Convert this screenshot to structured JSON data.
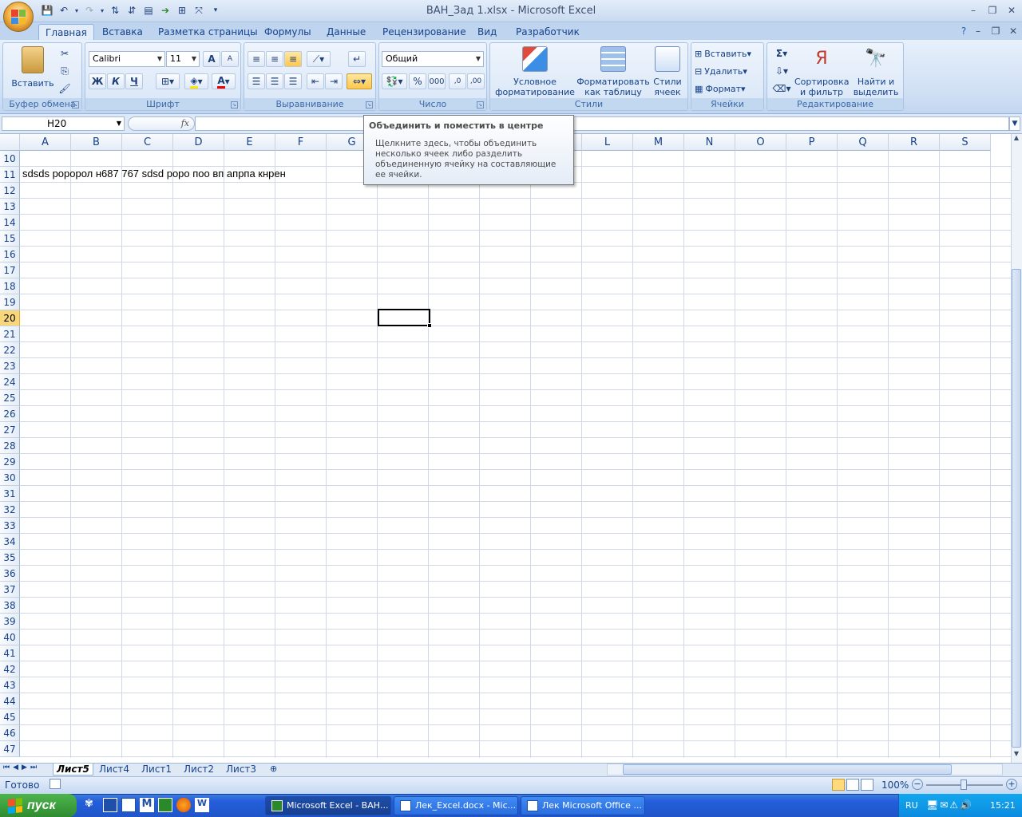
{
  "window": {
    "title": "ВАН_Зад 1.xlsx - Microsoft Excel",
    "minimize": "–",
    "restore": "❐",
    "close": "✕"
  },
  "qat": {
    "icons": [
      "save-icon",
      "undo-icon",
      "redo-icon",
      "sort-asc-icon",
      "sort-desc-icon",
      "form-icon",
      "arrow-icon",
      "print-area-icon",
      "fit-icon",
      "customize-icon"
    ]
  },
  "tabs": [
    {
      "label": "Главная",
      "active": true
    },
    {
      "label": "Вставка"
    },
    {
      "label": "Разметка страницы"
    },
    {
      "label": "Формулы"
    },
    {
      "label": "Данные"
    },
    {
      "label": "Рецензирование"
    },
    {
      "label": "Вид"
    },
    {
      "label": "Разработчик"
    }
  ],
  "ribbon": {
    "clipboard": {
      "label": "Буфер обмена",
      "paste": "Вставить"
    },
    "font": {
      "label": "Шрифт",
      "name": "Calibri",
      "size": "11",
      "bold": "Ж",
      "italic": "К",
      "underline": "Ч",
      "grow": "A",
      "shrink": "A"
    },
    "alignment": {
      "label": "Выравнивание"
    },
    "number": {
      "label": "Число",
      "format": "Общий",
      "percent": "%",
      "thousands": "000",
      "inc": ",0",
      "dec": ",00"
    },
    "styles": {
      "label": "Стили",
      "cond1": "Условное",
      "cond2": "форматирование",
      "table1": "Форматировать",
      "table2": "как таблицу",
      "cell1": "Стили",
      "cell2": "ячеек"
    },
    "cells": {
      "label": "Ячейки",
      "insert": "Вставить",
      "delete": "Удалить",
      "format": "Формат"
    },
    "editing": {
      "label": "Редактирование",
      "sort1": "Сортировка",
      "sort2": "и фильтр",
      "find1": "Найти и",
      "find2": "выделить",
      "sum": "Σ"
    }
  },
  "formula_bar": {
    "name_box": "H20",
    "fx": "fx",
    "content": ""
  },
  "tooltip": {
    "title": "Объединить и поместить в центре",
    "body": "Щелкните здесь, чтобы объединить несколько ячеек либо разделить объединенную ячейку на составляющие ее ячейки."
  },
  "grid": {
    "columns": [
      "A",
      "B",
      "C",
      "D",
      "E",
      "F",
      "G",
      "H",
      "I",
      "J",
      "K",
      "L",
      "M",
      "N",
      "O",
      "P",
      "Q",
      "R",
      "S"
    ],
    "rows": [
      "10",
      "11",
      "12",
      "13",
      "14",
      "15",
      "16",
      "17",
      "18",
      "19",
      "20",
      "21",
      "22",
      "23",
      "24",
      "25",
      "26",
      "27",
      "28",
      "29",
      "30",
      "31",
      "32",
      "33",
      "34",
      "35",
      "36",
      "37",
      "38",
      "39",
      "40",
      "41",
      "42",
      "43",
      "44",
      "45",
      "46",
      "47"
    ],
    "selected_row": "20",
    "cell_a11": "sdsds роророл н687 767  sdsd роро поо вп апрпа кнрен"
  },
  "sheets": [
    {
      "label": "Лист5",
      "active": true
    },
    {
      "label": "Лист4"
    },
    {
      "label": "Лист1"
    },
    {
      "label": "Лист2"
    },
    {
      "label": "Лист3"
    }
  ],
  "status": {
    "ready": "Готово",
    "zoom": "100%"
  },
  "taskbar": {
    "start": "пуск",
    "tasks": [
      {
        "label": "Microsoft Excel - ВАН...",
        "active": true
      },
      {
        "label": "Лек_Excel.docx - Mic..."
      },
      {
        "label": "Лек Microsoft Office ..."
      }
    ],
    "lang": "RU",
    "time": "15:21"
  },
  "colors": {
    "accent": "#15428b",
    "ribbon": "#d0e0f4",
    "selected_row": "#f8d77b",
    "taskbar": "#245edb",
    "start": "#2f8c2f"
  }
}
